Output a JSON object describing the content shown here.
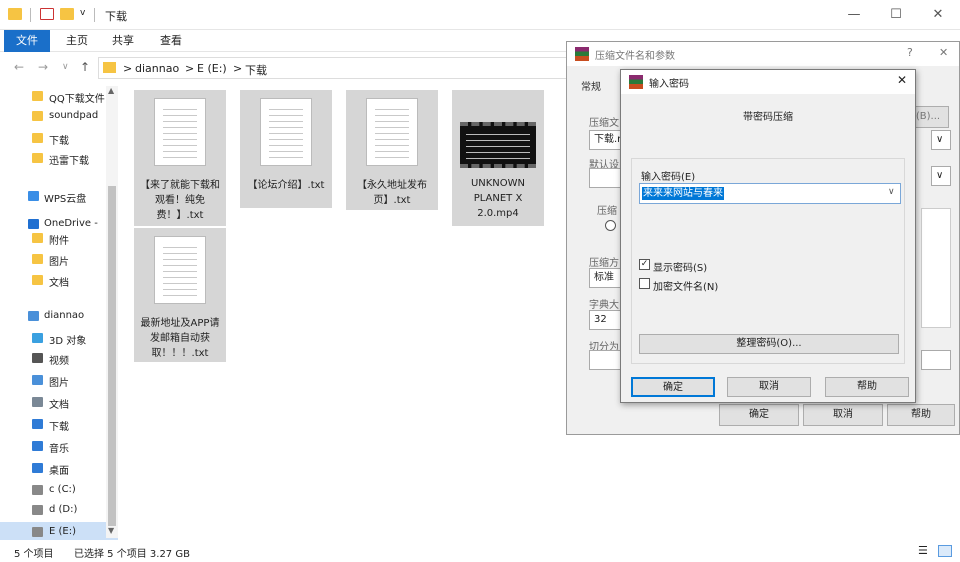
{
  "window": {
    "title": "下载",
    "quick_access_caret": "v"
  },
  "window_controls": {
    "minimize": "—",
    "maximize": "☐",
    "close": "✕"
  },
  "ribbon": {
    "tabs": [
      "文件",
      "主页",
      "共享",
      "查看"
    ]
  },
  "address": {
    "crumbs": [
      "diannao",
      "E (E:)",
      "下载"
    ],
    "sep": ">"
  },
  "sidebar": {
    "items": [
      {
        "label": "QQ下载文件",
        "icon": "folder-icon",
        "color": "#f6c443"
      },
      {
        "label": "soundpad",
        "icon": "folder-icon",
        "color": "#f6c443"
      },
      {
        "label": "下载",
        "icon": "folder-icon",
        "color": "#f6c443"
      },
      {
        "label": "迅雷下载",
        "icon": "folder-icon",
        "color": "#f6c443"
      },
      {
        "label": "WPS云盘",
        "icon": "cloud-icon",
        "color": "#3a8ee6"
      },
      {
        "label": "OneDrive -",
        "icon": "cloud-icon",
        "color": "#1f6fd1"
      },
      {
        "label": "附件",
        "icon": "folder-icon",
        "color": "#f6c443"
      },
      {
        "label": "图片",
        "icon": "folder-icon",
        "color": "#f6c443"
      },
      {
        "label": "文档",
        "icon": "folder-icon",
        "color": "#f6c443"
      },
      {
        "label": "diannao",
        "icon": "computer-icon",
        "color": "#4a90d9"
      },
      {
        "label": "3D 对象",
        "icon": "cube-icon",
        "color": "#3aa0e0"
      },
      {
        "label": "视频",
        "icon": "video-icon",
        "color": "#555555"
      },
      {
        "label": "图片",
        "icon": "picture-icon",
        "color": "#4a90d9"
      },
      {
        "label": "文档",
        "icon": "document-icon",
        "color": "#7a8896"
      },
      {
        "label": "下载",
        "icon": "download-icon",
        "color": "#2f7bd6"
      },
      {
        "label": "音乐",
        "icon": "music-icon",
        "color": "#2f7bd6"
      },
      {
        "label": "桌面",
        "icon": "desktop-icon",
        "color": "#2f7bd6"
      },
      {
        "label": "c (C:)",
        "icon": "drive-icon",
        "color": "#888888"
      },
      {
        "label": "d (D:)",
        "icon": "drive-icon",
        "color": "#888888"
      },
      {
        "label": "E (E:)",
        "icon": "drive-icon",
        "color": "#888888"
      }
    ]
  },
  "files": [
    {
      "name": "【来了就能下载和观看！纯免费！】.txt",
      "icon": "text-file-icon"
    },
    {
      "name": "【论坛介绍】.txt",
      "icon": "text-file-icon"
    },
    {
      "name": "【永久地址发布页】.txt",
      "icon": "text-file-icon"
    },
    {
      "name": "UNKNOWN PLANET X 2.0.mp4",
      "icon": "video-file-icon"
    },
    {
      "name": "最新地址及APP请发邮箱自动获取！！！.txt",
      "icon": "text-file-icon"
    }
  ],
  "status": {
    "count": "5 个项目",
    "selected": "已选择 5 个项目  3.27 GB"
  },
  "archive_dialog": {
    "title": "压缩文件名和参数",
    "help": "?",
    "tab": "常规",
    "labels": [
      "压缩文",
      "默认设",
      "压缩",
      "压缩方",
      "字典大",
      "切分为"
    ],
    "filename_value": "下载.r",
    "browse": "览(B)...",
    "method_value": "标准",
    "dict_value": "32",
    "buttons": {
      "ok": "确定",
      "cancel": "取消",
      "help": "帮助"
    }
  },
  "password_dialog": {
    "title": "输入密码",
    "heading": "带密码压缩",
    "input_label": "输入密码(E)",
    "password_value": "来来来网站与春来",
    "show_password": "显示密码(S)",
    "encrypt_filenames": "加密文件名(N)",
    "organize": "整理密码(O)...",
    "ok": "确定",
    "cancel": "取消",
    "help": "帮助",
    "close": "✕"
  }
}
